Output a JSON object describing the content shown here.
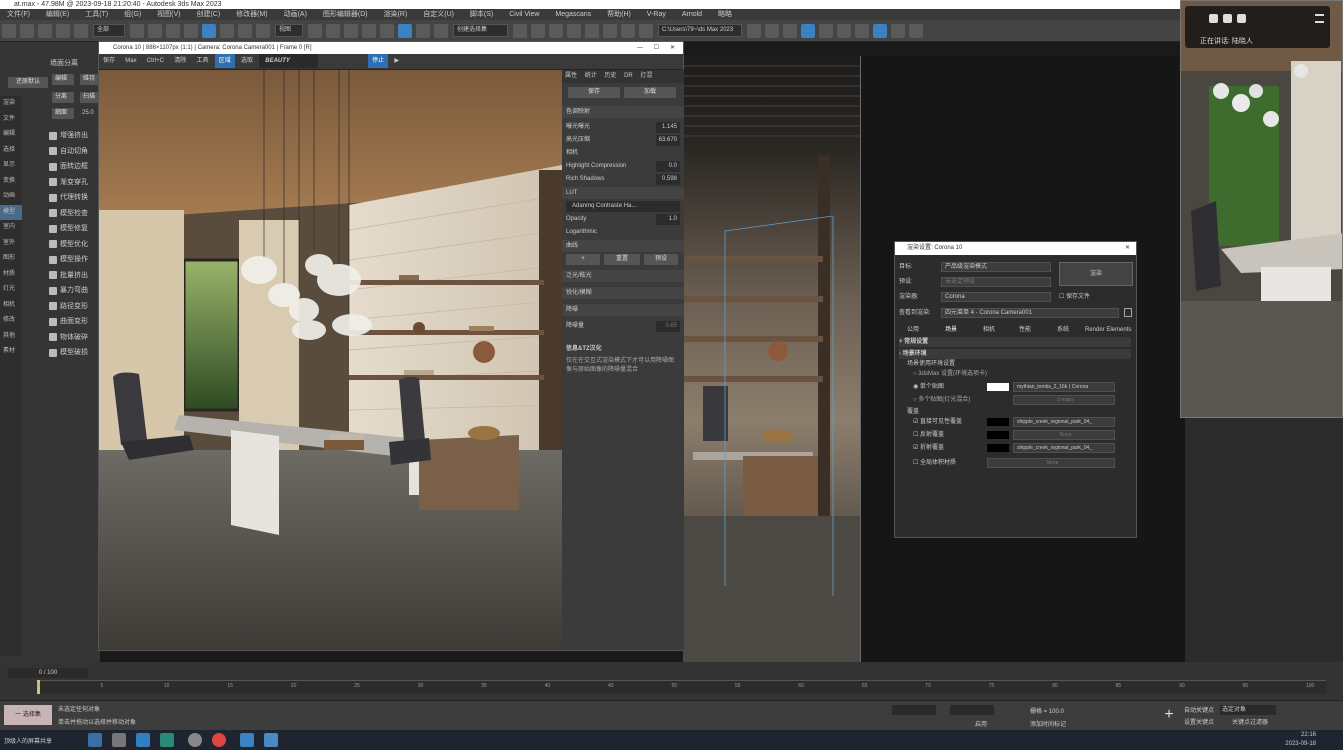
{
  "window": {
    "title": "at.max - 47.98M @ 2023-09-18 21:20:40 - Autodesk 3ds Max 2023"
  },
  "menu": [
    "文件(F)",
    "编辑(E)",
    "工具(T)",
    "组(G)",
    "视图(V)",
    "创建(C)",
    "修改器(M)",
    "动画(A)",
    "图形编辑器(D)",
    "渲染(R)",
    "自定义(U)",
    "脚本(S)",
    "Civil View",
    "Megascans",
    "帮助(H)",
    "V-Ray",
    "Arnold",
    "略略"
  ],
  "toolbar": {
    "filter_value": "全部",
    "view_value": "视图",
    "selection_set": "创建选择集",
    "path_field": "C:\\Users\\79~\\ds Max 2023"
  },
  "left_panel": {
    "restore_button": "还原默认",
    "wall_split": "墙面分离",
    "sub_buttons": [
      "编辑",
      "维持",
      "分离",
      "扫描",
      "细面",
      "25.0"
    ],
    "side_labels": [
      "渲染",
      "文件",
      "编辑",
      "选择",
      "显示",
      "变换",
      "动画",
      "模型",
      "室内",
      "室外",
      "图形",
      "材质",
      "灯光",
      "相机",
      "修改",
      "其他",
      "素材"
    ],
    "tools": [
      "增强挤出",
      "自动切角",
      "面转边框",
      "渐变穿孔",
      "代理转换",
      "模型检查",
      "模型修复",
      "模型优化",
      "模型操作",
      "批量挤出",
      "暴力弯曲",
      "路径变形",
      "曲面变形",
      "物体破碎",
      "模型破损"
    ]
  },
  "vfb": {
    "title": "Corona 10 | 886×1107px (1:1) | Camera: Corona Camera001 | Frame 0 [R]",
    "toolbar": [
      "保存",
      "Max",
      "Ctrl+C",
      "清除",
      "工具",
      "区域",
      "选取",
      "BEAUTY"
    ],
    "stop": "停止",
    "tabs": [
      "属性",
      "统计",
      "历史",
      "DR",
      "灯混"
    ],
    "save": "保存",
    "load": "加载",
    "section_tone": "色调映射",
    "exposure_label": "曝光曝光",
    "exposure_value": "1.145",
    "highlight_label": "高光压缩",
    "highlight_value": "63.670",
    "camera_label": "相机",
    "hl_comp_label": "Highlight Compression",
    "hl_comp_value": "0.0",
    "rich_label": "Rich Shadows",
    "rich_value": "0.598",
    "lut_label": "LUT",
    "lut_value": "Adanmq Contraste Ha...",
    "opacity_label": "Opacity",
    "opacity_value": "1.0",
    "log_label": "Logarithmic",
    "curve_label": "曲线",
    "reset": "重置",
    "preset": "预设",
    "bloom": "泛光/眩光",
    "sharpen": "锐化/模糊",
    "denoise": "降噪",
    "denoise_amt_label": "降噪量",
    "denoise_amt_value": "0.65",
    "info_title": "信息&TZ汉化",
    "info_text": "仅在在交互式渲染模式下才可以用降噪图像与原始图像的降噪量混合"
  },
  "render_setup": {
    "title": "渲染设置: Corona 10",
    "target_label": "目标:",
    "target_value": "产品级渲染模式",
    "preset_label": "预设:",
    "preset_value": "未选定预设",
    "renderer_label": "渲染器:",
    "renderer_value": "Corona",
    "render_button": "渲染",
    "save_file": "保存文件",
    "view_label": "查看到渲染:",
    "view_value": "四元菜单 4 - Corona Camera001",
    "tabs": [
      "公用",
      "场景",
      "相机",
      "性能",
      "系统",
      "Render Elements"
    ],
    "section_common": "常规设置",
    "section_env": "场景环境",
    "env_source": "场景使用环境设置",
    "env_opt1": "3dsMax 设置(环境选项卡)",
    "env_opt2": "单个贴图",
    "env_map": "mythian_tombs_2_16k ( Corona",
    "env_opt3": "多个贴图(灯光混合)",
    "env_opt3_value": "0 maps",
    "override_label": "覆盖",
    "direct": "直接可见性覆盖",
    "direct_map": "shipple_creek_regional_park_04_",
    "refl": "反射覆盖",
    "refl_value": "None",
    "refr": "折射覆盖",
    "refr_map": "shipple_creek_regional_park_04_",
    "global_vol": "全局体积材质",
    "global_vol_value": "None"
  },
  "meeting": {
    "speaking_label": "正在讲话:",
    "speaker": "陆晓人"
  },
  "timeline": {
    "frame_counter": "0 / 100",
    "ticks": [
      "0",
      "5",
      "10",
      "15",
      "20",
      "25",
      "30",
      "35",
      "40",
      "45",
      "50",
      "55",
      "60",
      "65",
      "70",
      "75",
      "80",
      "85",
      "90",
      "95",
      "100"
    ]
  },
  "status": {
    "selection_label": "一 选择集",
    "line1": "未选定任何对象",
    "line2": "单击并拖动以选择并移动对象",
    "enable": "启用",
    "add_time_tag": "添加时间标记",
    "grid_label": "栅格 = 100.0",
    "auto_key": "自动关键点",
    "set_key": "设置关键点",
    "selected_obj": "选定对象",
    "key_filters": "关键点过滤器"
  },
  "taskbar": {
    "app_label": "顶级人的屏幕共享",
    "time": "22:16",
    "date": "2023-09-18"
  },
  "colors": {
    "accent": "#3b82c4",
    "timeline_marker": "#d9c55a"
  }
}
